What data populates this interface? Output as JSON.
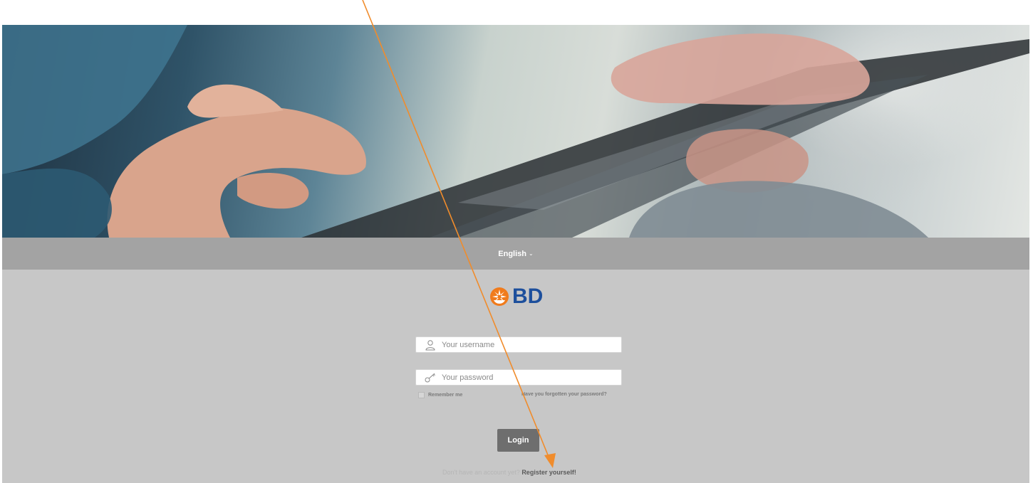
{
  "language": {
    "selected": "English"
  },
  "logo": {
    "text": "BD"
  },
  "login_form": {
    "username": {
      "value": "",
      "placeholder": "Your username"
    },
    "password": {
      "value": "",
      "placeholder": "Your password"
    },
    "remember_label": "Remember me",
    "forgot_label": "Have you forgotten your password?",
    "login_label": "Login"
  },
  "register": {
    "question": "Don't have an account yet?",
    "link_label": "Register yourself!"
  },
  "colors": {
    "annotation_arrow": "#f08c2c",
    "brand_blue": "#1d4f9c",
    "brand_orange": "#f07b1c",
    "lang_bar": "#a3a3a3",
    "main_bg": "#c7c7c7",
    "login_button": "#6e6e6e"
  },
  "icons": [
    "user-icon",
    "key-icon",
    "bd-sunburst-icon",
    "chevron-down-icon"
  ]
}
